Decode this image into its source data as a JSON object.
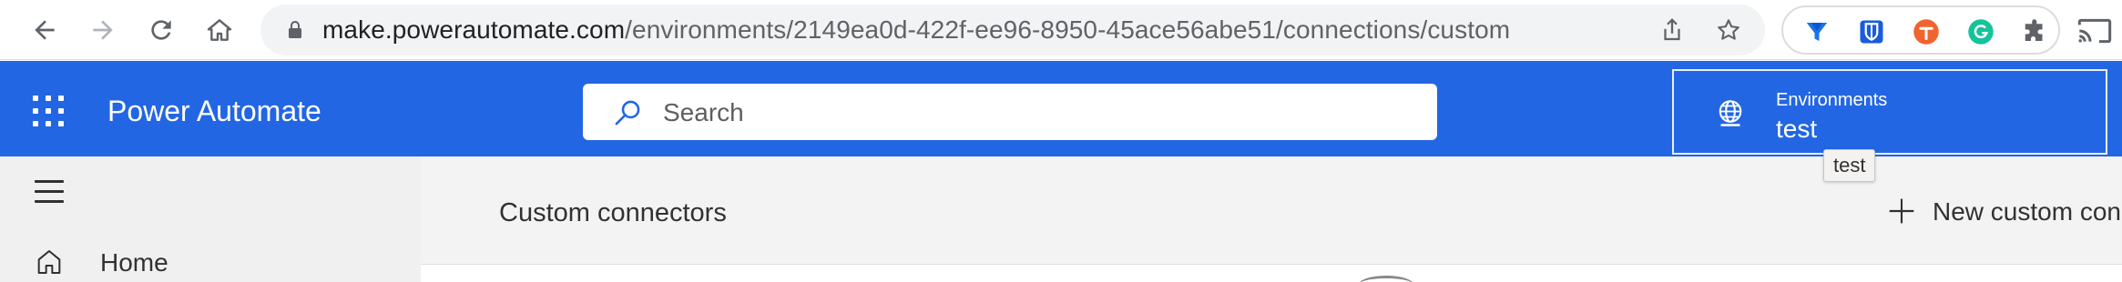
{
  "browser": {
    "url_host": "make.powerautomate.com",
    "url_path": "/environments/2149ea0d-422f-ee96-8950-45ace56abe51/connections/custom",
    "nav_icons": [
      "back-icon",
      "forward-icon",
      "reload-icon",
      "home-icon"
    ],
    "omnibox_actions": [
      "share-icon",
      "bookmark-star-icon"
    ],
    "extensions": [
      "filter-funnel-extension-icon",
      "bitwarden-extension-icon",
      "tampermonkey-extension-icon",
      "grammarly-extension-icon",
      "extensions-puzzle-icon"
    ],
    "cast_icon": "cast-icon"
  },
  "header": {
    "app_title": "Power Automate",
    "search": {
      "placeholder": "Search"
    },
    "environment": {
      "label": "Environments",
      "value": "test"
    },
    "colors": {
      "header_bg": "#2266e3",
      "accent": "#2266e3"
    }
  },
  "tooltip": {
    "text": "test"
  },
  "left_nav": {
    "items": [
      {
        "label": "Home",
        "icon": "home-icon"
      }
    ]
  },
  "main": {
    "title": "Custom connectors",
    "new_button_label": "New custom con"
  }
}
